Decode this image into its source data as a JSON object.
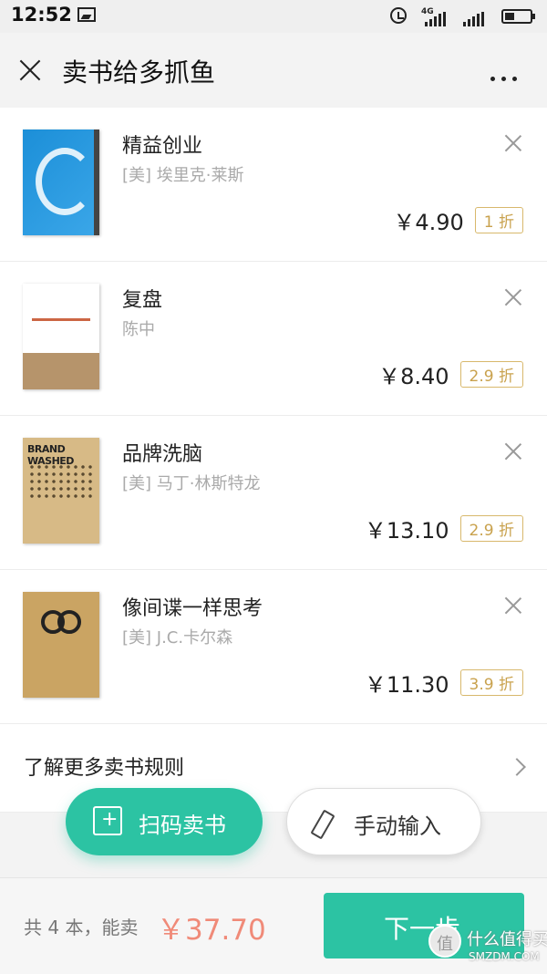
{
  "status": {
    "time": "12:52",
    "network": "4G"
  },
  "header": {
    "title": "卖书给多抓鱼"
  },
  "books": [
    {
      "title": "精益创业",
      "author": "[美] 埃里克·莱斯",
      "price": "￥4.90",
      "discount": "1 折",
      "cover_icon": "book-cover-lean-startup"
    },
    {
      "title": "复盘",
      "author": "陈中",
      "price": "￥8.40",
      "discount": "2.9 折",
      "cover_icon": "book-cover-fupan"
    },
    {
      "title": "品牌洗脑",
      "author": "[美] 马丁·林斯特龙",
      "price": "￥13.10",
      "discount": "2.9 折",
      "cover_icon": "book-cover-brandwashed"
    },
    {
      "title": "像间谍一样思考",
      "author": "[美] J.C.卡尔森",
      "price": "￥11.30",
      "discount": "3.9 折",
      "cover_icon": "book-cover-spy"
    }
  ],
  "covers": {
    "brandwashed_text": "BRAND WASHED"
  },
  "rules": {
    "label": "了解更多卖书规则"
  },
  "actions": {
    "scan_label": "扫码卖书",
    "manual_label": "手动输入"
  },
  "footer": {
    "summary": "共 4 本，能卖",
    "total": "￥37.70",
    "next_label": "下一步"
  },
  "watermark": {
    "title": "什么值得买",
    "domain": "SMZDM.COM"
  },
  "colors": {
    "accent": "#2cc3a3",
    "price_total": "#f08a78",
    "discount": "#c9a24e"
  }
}
